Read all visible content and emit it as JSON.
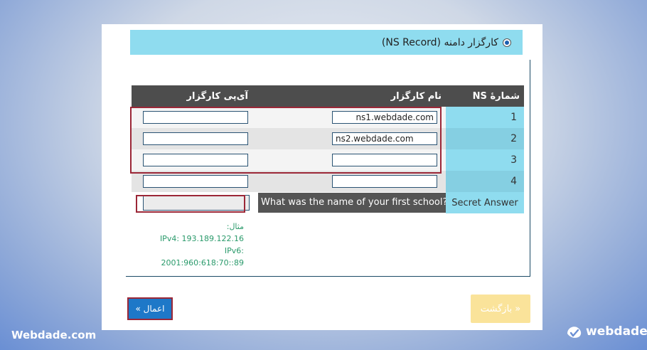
{
  "header": {
    "option_label": "کارگزار دامنه (NS Record)",
    "selected": true
  },
  "table": {
    "headers": {
      "ns_number": "شمارهٔ NS",
      "server_name": "نام کارگزار",
      "server_ip": "آی‌پی کارگزار"
    },
    "rows": [
      {
        "num": "1",
        "name": "ns1.webdade.com",
        "ip": ""
      },
      {
        "num": "2",
        "name": "ns2.webdade.com",
        "ip": ""
      },
      {
        "num": "3",
        "name": "",
        "ip": ""
      },
      {
        "num": "4",
        "name": "",
        "ip": ""
      }
    ],
    "secret": {
      "label": "Secret Answer",
      "question": "What was the name of your first school?",
      "answer": ""
    }
  },
  "examples": {
    "title": "مثال:",
    "ipv4": "IPv4: 193.189.122.16",
    "ipv6": "IPv6: 2001:960:618:70::89"
  },
  "buttons": {
    "apply": "اعمال »",
    "back": "« بازگشت"
  },
  "watermark": {
    "left": "Webdade.com",
    "right": "webdade"
  },
  "colors": {
    "accent": "#8fdcef",
    "apply_button": "#1e78c8",
    "back_button": "#fae39a",
    "highlight": "#9b2737",
    "example_text": "#2a9a6b"
  }
}
